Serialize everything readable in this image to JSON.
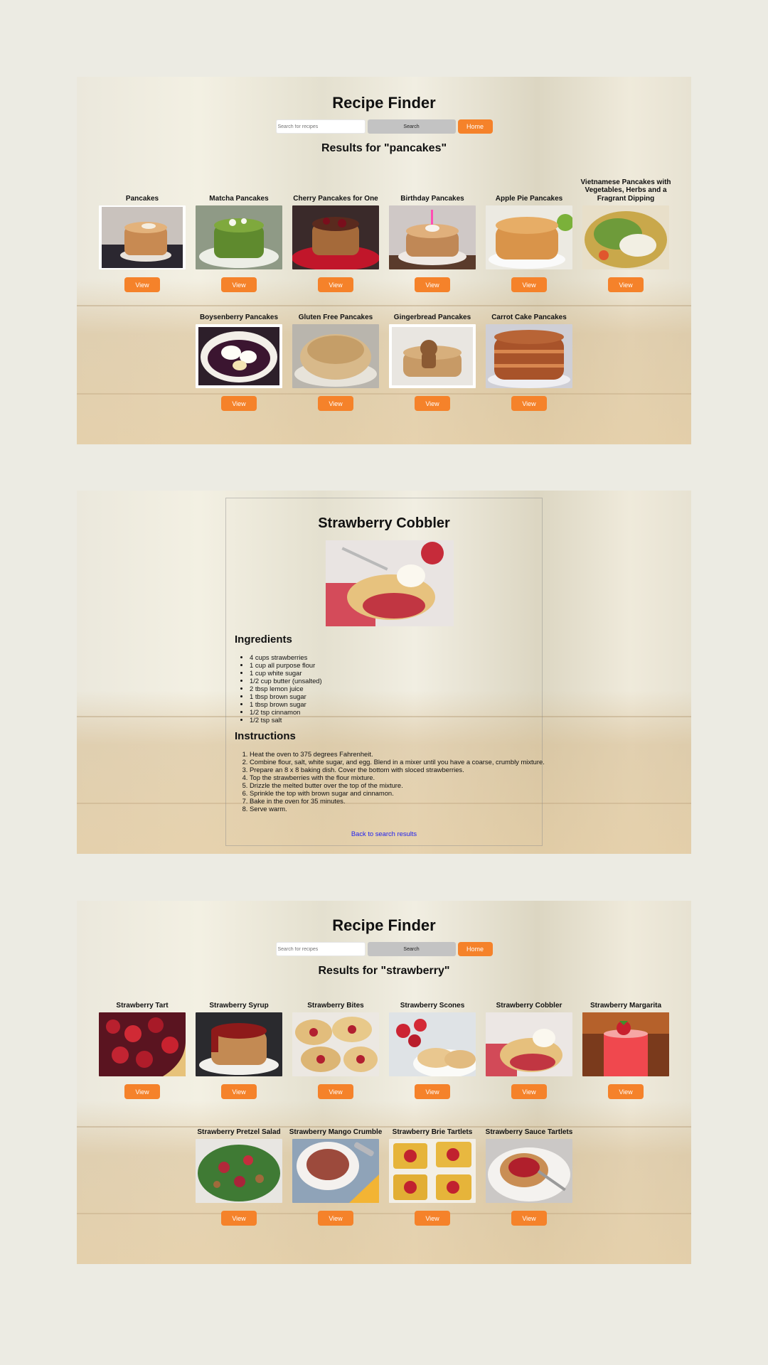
{
  "colors": {
    "accent": "#f5822a",
    "search_button": "#c3c3c3",
    "link": "#2222ee",
    "page_bg": "#ecebe3"
  },
  "search_page_1": {
    "title": "Recipe Finder",
    "search_placeholder": "Search for recipes",
    "search_label": "Search",
    "home_label": "Home",
    "results_heading": "Results for \"pancakes\"",
    "view_label": "View",
    "recipes": [
      {
        "title": "Pancakes"
      },
      {
        "title": "Matcha Pancakes"
      },
      {
        "title": "Cherry Pancakes for One"
      },
      {
        "title": "Birthday Pancakes"
      },
      {
        "title": "Apple Pie Pancakes"
      },
      {
        "title": "Vietnamese Pancakes with Vegetables, Herbs and a Fragrant Dipping"
      },
      {
        "title": "Boysenberry Pancakes"
      },
      {
        "title": "Gluten Free Pancakes"
      },
      {
        "title": "Gingerbread Pancakes"
      },
      {
        "title": "Carrot Cake Pancakes"
      }
    ]
  },
  "detail_page": {
    "title": "Strawberry Cobbler",
    "ingredients_heading": "Ingredients",
    "ingredients": [
      "4 cups strawberries",
      "1 cup all purpose flour",
      "1 cup white sugar",
      "1/2 cup butter (unsalted)",
      "2 tbsp lemon juice",
      "1 tbsp brown sugar",
      "1 tbsp brown sugar",
      "1/2 tsp cinnamon",
      "1/2 tsp salt"
    ],
    "instructions_heading": "Instructions",
    "instructions": [
      "Heat the oven to 375 degrees Fahrenheit.",
      "Combine flour, salt, white sugar, and egg. Blend in a mixer until you have a coarse, crumbly mixture.",
      "Prepare an 8 x 8 baking dish. Cover the bottom with sloced strawberries.",
      "Top the strawberries with the flour mixture.",
      "Drizzle the melted butter over the top of the mixture.",
      "Sprinkle the top with brown sugar and cinnamon.",
      "Bake in the oven for 35 minutes.",
      "Serve warm."
    ],
    "back_link": "Back to search results"
  },
  "search_page_2": {
    "title": "Recipe Finder",
    "search_placeholder": "Search for recipes",
    "search_label": "Search",
    "home_label": "Home",
    "results_heading": "Results for \"strawberry\"",
    "view_label": "View",
    "recipes": [
      {
        "title": "Strawberry Tart"
      },
      {
        "title": "Strawberry Syrup"
      },
      {
        "title": "Strawberry Bites"
      },
      {
        "title": "Strawberry Scones"
      },
      {
        "title": "Strawberry Cobbler"
      },
      {
        "title": "Strawberry Margarita"
      },
      {
        "title": "Strawberry Pretzel Salad"
      },
      {
        "title": "Strawberry Mango Crumble"
      },
      {
        "title": "Strawberry Brie Tartlets"
      },
      {
        "title": "Strawberry Sauce Tartlets"
      }
    ]
  }
}
